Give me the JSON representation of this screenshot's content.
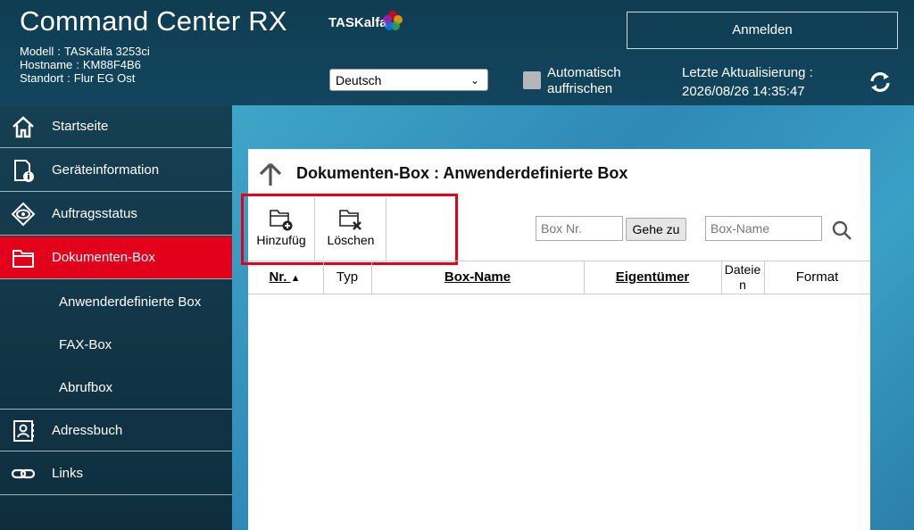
{
  "header": {
    "app_title": "Command Center RX",
    "model_label": "Modell",
    "model_value": "TASKalfa 3253ci",
    "hostname_label": "Hostname",
    "hostname_value": "KM88F4B6",
    "location_label": "Standort",
    "location_value": "Flur EG Ost",
    "brand": "TASKalfa",
    "language": "Deutsch",
    "auto_refresh_line1": "Automatisch",
    "auto_refresh_line2": "auffrischen",
    "login_button": "Anmelden",
    "last_update_label": "Letzte Aktualisierung :",
    "last_update_value": "2026/08/26 14:35:47"
  },
  "sidebar": {
    "items": [
      {
        "label": "Startseite",
        "icon": "home-icon"
      },
      {
        "label": "Geräteinformation",
        "icon": "device-info-icon"
      },
      {
        "label": "Auftragsstatus",
        "icon": "eye-icon"
      },
      {
        "label": "Dokumenten-Box",
        "icon": "folder-icon",
        "active": true
      },
      {
        "label": "Adressbuch",
        "icon": "address-book-icon"
      },
      {
        "label": "Links",
        "icon": "link-icon"
      }
    ],
    "sub_items": [
      "Anwenderdefinierte Box",
      "FAX-Box",
      "Abrufbox"
    ]
  },
  "main": {
    "title": "Dokumenten-Box : Anwenderdefinierte Box",
    "toolbar": {
      "add_label": "Hinzufüg",
      "delete_label": "Löschen"
    },
    "box_nr_placeholder": "Box Nr.",
    "goto_button": "Gehe zu",
    "box_name_placeholder": "Box-Name",
    "columns": [
      "Nr.",
      "Typ",
      "Box-Name",
      "Eigentümer",
      "Dateie n",
      "Format"
    ]
  },
  "colors": {
    "accent": "#e3001b",
    "header_bg": "#0f3d52"
  }
}
